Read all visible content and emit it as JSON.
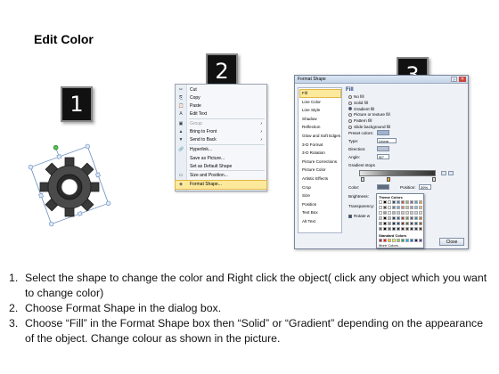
{
  "title": "Edit Color",
  "badges": [
    "1",
    "2",
    "3"
  ],
  "context_menu": {
    "items": [
      {
        "icon": "✂",
        "label": "Cut",
        "disabled": false,
        "submenu": false,
        "highlight": false
      },
      {
        "icon": "⎘",
        "label": "Copy",
        "disabled": false,
        "submenu": false,
        "highlight": false
      },
      {
        "icon": "📋",
        "label": "Paste",
        "disabled": false,
        "submenu": false,
        "highlight": false
      },
      {
        "icon": "A",
        "label": "Edit Text",
        "disabled": false,
        "submenu": false,
        "highlight": false
      },
      {
        "icon": "▣",
        "label": "Group",
        "disabled": true,
        "submenu": true,
        "highlight": false
      },
      {
        "icon": "▲",
        "label": "Bring to Front",
        "disabled": false,
        "submenu": true,
        "highlight": false
      },
      {
        "icon": "▼",
        "label": "Send to Back",
        "disabled": false,
        "submenu": true,
        "highlight": false
      },
      {
        "icon": "🔗",
        "label": "Hyperlink...",
        "disabled": false,
        "submenu": false,
        "highlight": false
      },
      {
        "icon": "",
        "label": "Save as Picture...",
        "disabled": false,
        "submenu": false,
        "highlight": false
      },
      {
        "icon": "",
        "label": "Set as Default Shape",
        "disabled": false,
        "submenu": false,
        "highlight": false
      },
      {
        "icon": "▭",
        "label": "Size and Position...",
        "disabled": false,
        "submenu": false,
        "highlight": false
      },
      {
        "icon": "◈",
        "label": "Format Shape...",
        "disabled": false,
        "submenu": false,
        "highlight": true
      }
    ],
    "arrow": "›"
  },
  "dialog": {
    "title": "Format Shape",
    "close_glyph": "✕",
    "help_glyph": "?",
    "nav_items": [
      "Fill",
      "Line Color",
      "Line Style",
      "Shadow",
      "Reflection",
      "Glow and Soft Edges",
      "3-D Format",
      "3-D Rotation",
      "Picture Corrections",
      "Picture Color",
      "Artistic Effects",
      "Crop",
      "Size",
      "Position",
      "Text Box",
      "Alt Text"
    ],
    "selected_nav": "Fill",
    "pane_heading": "Fill",
    "fill_options": [
      {
        "label": "No fill",
        "selected": false
      },
      {
        "label": "Solid fill",
        "selected": false
      },
      {
        "label": "Gradient fill",
        "selected": true
      },
      {
        "label": "Picture or texture fill",
        "selected": false
      },
      {
        "label": "Pattern fill",
        "selected": false
      },
      {
        "label": "Slide background fill",
        "selected": false
      }
    ],
    "preset_label": "Preset colors:",
    "type_label": "Type:",
    "type_value": "Linear",
    "direction_label": "Direction:",
    "angle_label": "Angle:",
    "angle_value": "90°",
    "stops_label": "Gradient stops",
    "color_label": "Color:",
    "position_label": "Position:",
    "position_value": "39%",
    "brightness_label": "Brightness:",
    "transparency_label": "Transparency:",
    "rotate_label": "Rotate w",
    "close_label": "Close",
    "palette": {
      "theme_label": "Theme Colors",
      "standard_label": "Standard Colors",
      "more_label": "More Colors...",
      "theme_colors": [
        "#ffffff",
        "#000000",
        "#eeece1",
        "#1f497d",
        "#4f81bd",
        "#c0504d",
        "#9bbb59",
        "#8064a2",
        "#4bacc6",
        "#f79646"
      ],
      "standard_colors": [
        "#c00000",
        "#ff0000",
        "#ffc000",
        "#ffff00",
        "#92d050",
        "#00b050",
        "#00b0f0",
        "#0070c0",
        "#002060",
        "#7030a0"
      ]
    }
  },
  "instructions": [
    {
      "num": "1.",
      "text": "Select the shape to change the color and Right click the object( click any object which you want to change color)"
    },
    {
      "num": "2.",
      "text": "Choose Format Shape in the dialog box."
    },
    {
      "num": "3.",
      "text": "Choose “Fill” in the Format Shape box then “Solid” or “Gradient” depending on the appearance of the object. Change colour as shown in the picture."
    }
  ]
}
